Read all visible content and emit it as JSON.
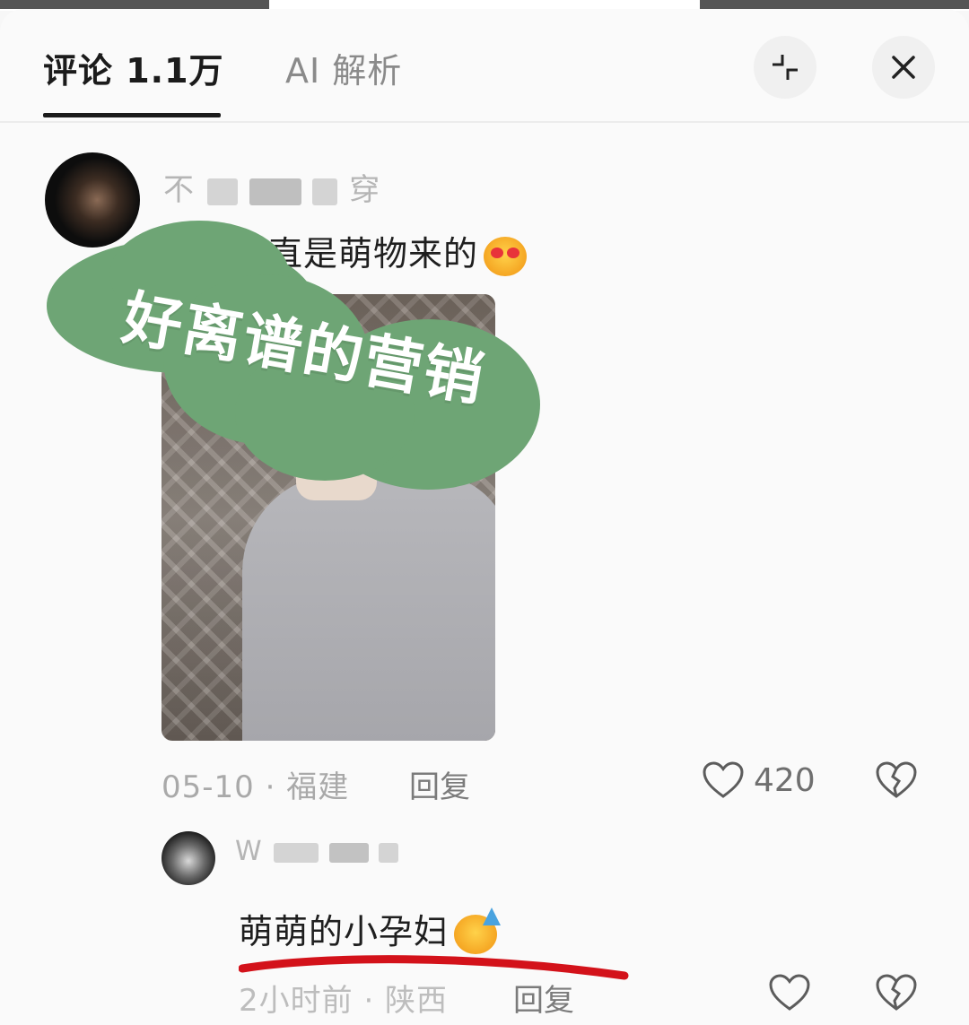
{
  "tabs": {
    "comments": "评论 1.1万",
    "ai_analysis": "AI 解析"
  },
  "comments": [
    {
      "username": "不",
      "username_end": "穿",
      "text": "戈毅简直是萌物来的",
      "emoji": "heart-eyes-emoji",
      "date": "05-10 · 福建",
      "reply_label": "回复",
      "likes": "420"
    },
    {
      "username": "W",
      "text": "萌萌的小孕妇",
      "emoji": "party-face-emoji",
      "date": "2小时前 · 陕西",
      "reply_label": "回复"
    }
  ],
  "sticker": {
    "label": "好离谱的营销",
    "color": "#6ea575"
  },
  "colors": {
    "annotation_underline": "#d3121a"
  }
}
